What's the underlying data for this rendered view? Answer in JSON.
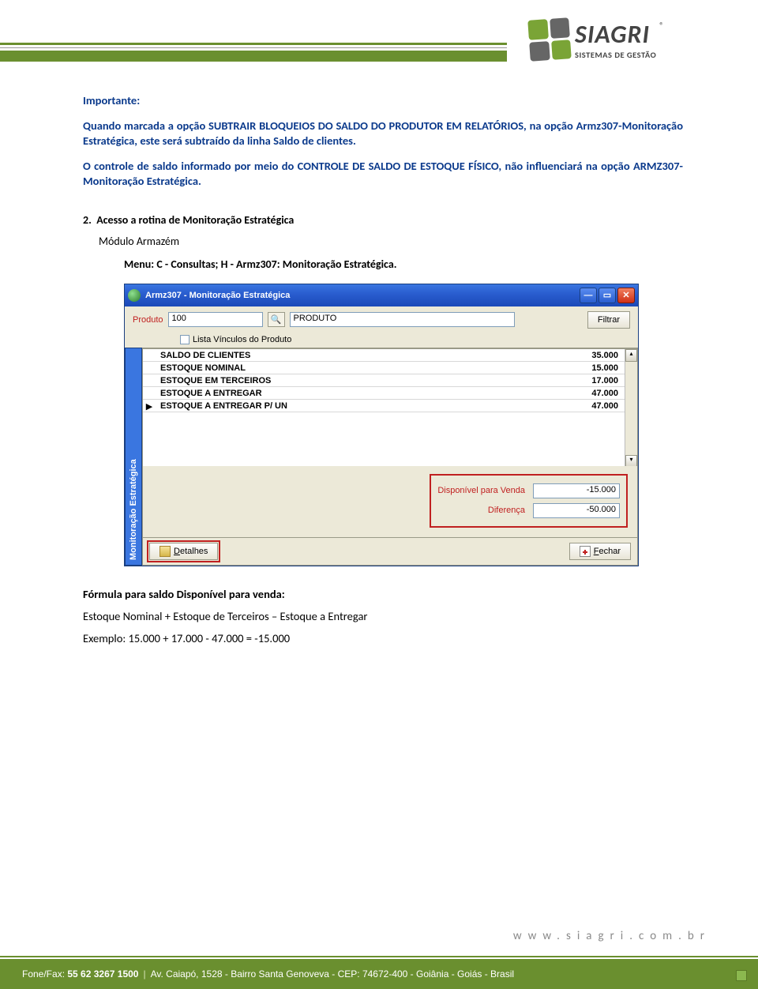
{
  "header": {
    "logo_name": "SIAGRI",
    "logo_sub": "SISTEMAS DE GESTÃO"
  },
  "doc": {
    "important_label": "Importante:",
    "p1": "Quando marcada a opção SUBTRAIR BLOQUEIOS DO SALDO DO PRODUTOR EM RELATÓRIOS, na opção Armz307-Monitoração Estratégica, este será subtraído da linha Saldo de clientes.",
    "p2": "O controle de saldo informado por meio do CONTROLE DE SALDO DE ESTOQUE FÍSICO, não influenciará na opção ARMZ307- Monitoração Estratégica.",
    "section_num": "2.",
    "section_title": "Acesso a rotina de Monitoração Estratégica",
    "module_line": "Módulo Armazém",
    "menu_line": "Menu: C - Consultas;  H - Armz307: Monitoração Estratégica.",
    "below_heading": "Fórmula para saldo Disponível para venda:",
    "below_formula": "Estoque Nominal + Estoque de Terceiros – Estoque a Entregar",
    "below_example": "Exemplo: 15.000 + 17.000 - 47.000 = -15.000"
  },
  "app": {
    "title": "Armz307 - Monitoração Estratégica",
    "produto_label": "Produto",
    "produto_value": "100",
    "produto_name": "PRODUTO",
    "filtrar_label": "Filtrar",
    "lista_vinculos_label": "Lista Vínculos do Produto",
    "side_tab": "Monitoração Estratégica",
    "rows": [
      {
        "label": "SALDO DE CLIENTES",
        "value": "35.000"
      },
      {
        "label": "ESTOQUE NOMINAL",
        "value": "15.000"
      },
      {
        "label": "ESTOQUE EM TERCEIROS",
        "value": "17.000"
      },
      {
        "label": "ESTOQUE A ENTREGAR",
        "value": "47.000"
      },
      {
        "label": "ESTOQUE A ENTREGAR P/ UN",
        "value": "47.000"
      }
    ],
    "summary": {
      "disp_label": "Disponível para Venda",
      "disp_value": "-15.000",
      "dif_label": "Diferença",
      "dif_value": "-50.000"
    },
    "detalhes_label": "Detalhes",
    "fechar_label": "Fechar"
  },
  "footer": {
    "url": "www.siagri.com.br",
    "phone_label": "Fone/Fax:",
    "phone": "55 62 3267 1500",
    "address": "Av. Caiapó, 1528 - Bairro Santa Genoveva - CEP: 74672-400 - Goiânia - Goiás - Brasil"
  }
}
